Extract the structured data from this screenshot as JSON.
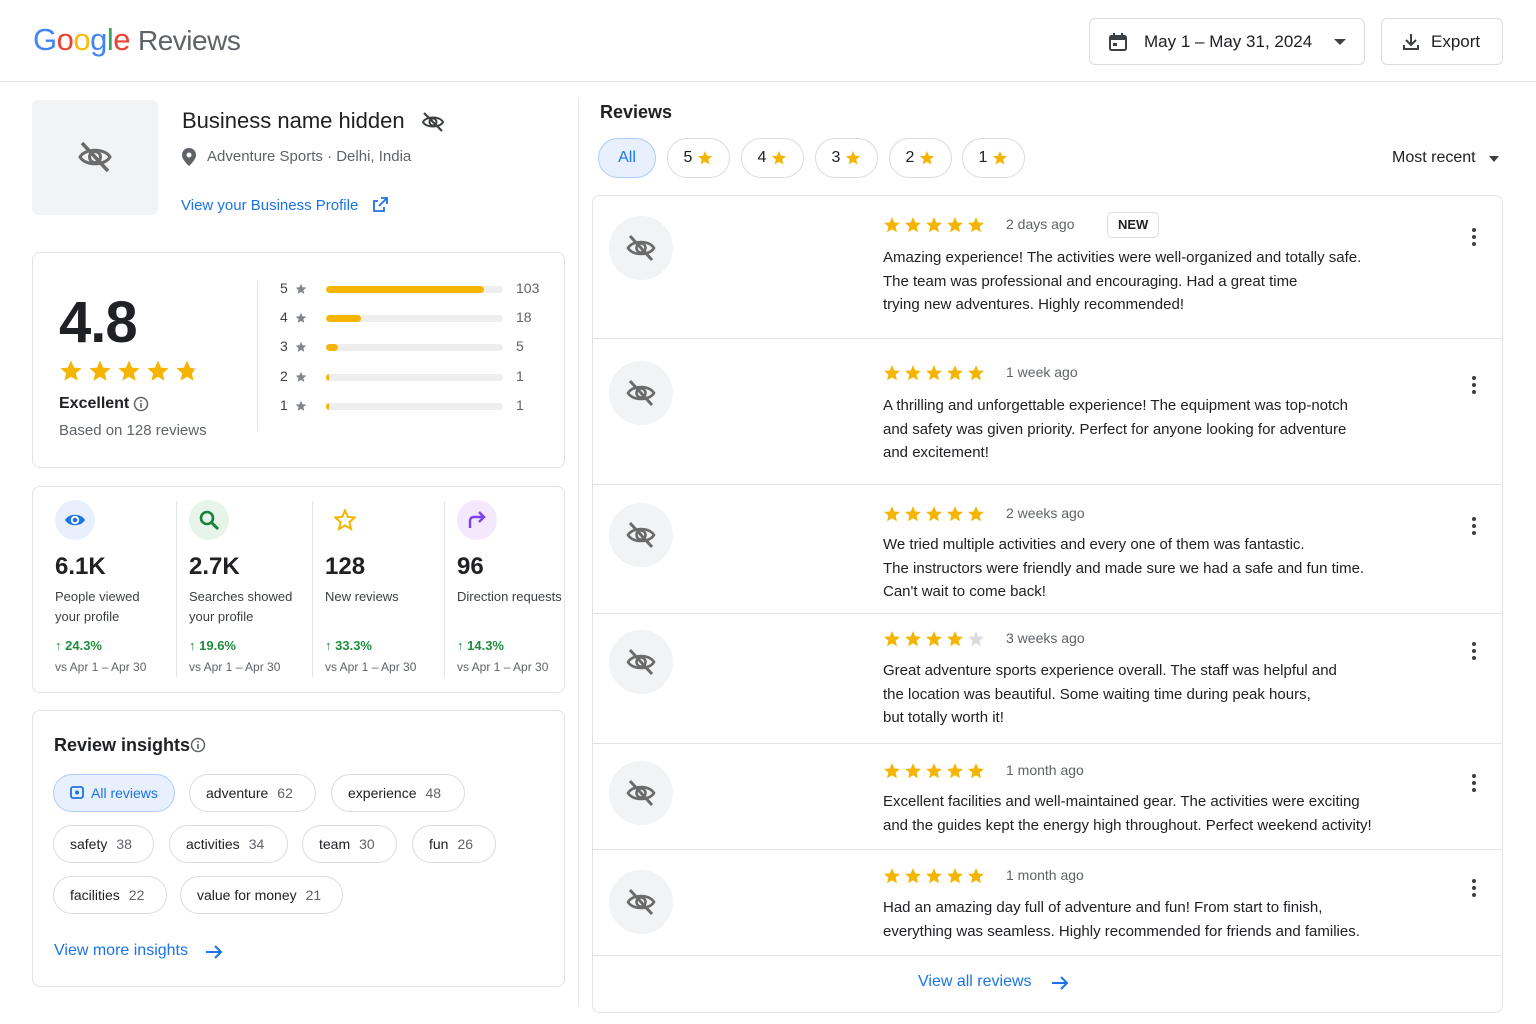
{
  "header": {
    "logo_google": "Google",
    "logo_product": "Reviews",
    "date_range": "May 1 – May 31, 2024",
    "export_label": "Export"
  },
  "business": {
    "name": "Business name hidden",
    "location": "Adventure Sports · Delhi, India",
    "profile_link": "View your Business Profile"
  },
  "rating": {
    "value": "4.8",
    "stars": 4.8,
    "label": "Excellent",
    "based_on": "Based on 128 reviews",
    "distribution": [
      {
        "star": "5",
        "count": "103",
        "fraction": 0.89
      },
      {
        "star": "4",
        "count": "18",
        "fraction": 0.2
      },
      {
        "star": "3",
        "count": "5",
        "fraction": 0.07
      },
      {
        "star": "2",
        "count": "1",
        "fraction": 0.015
      },
      {
        "star": "1",
        "count": "1",
        "fraction": 0.015
      }
    ]
  },
  "stats": [
    {
      "icon": "eye-icon",
      "value": "6.1K",
      "label": "People viewed your profile",
      "change": "24.3%",
      "compare": "vs Apr 1 – Apr 30",
      "color": "#1a73e8",
      "bg": "#e8f0fe"
    },
    {
      "icon": "search-icon",
      "value": "2.7K",
      "label": "Searches showed your profile",
      "change": "19.6%",
      "compare": "vs Apr 1 – Apr 30",
      "color": "#188038",
      "bg": "#e6f4ea"
    },
    {
      "icon": "star-outline-icon",
      "value": "128",
      "label": "New reviews",
      "change": "33.3%",
      "compare": "vs Apr 1 – Apr 30",
      "color": "#f4b400",
      "bg": "#ffffff"
    },
    {
      "icon": "direction-arrow-icon",
      "value": "96",
      "label": "Direction requests",
      "change": "14.3%",
      "compare": "vs Apr 1 – Apr 30",
      "color": "#7b3ff2",
      "bg": "#f3e8fd"
    }
  ],
  "insights": {
    "title": "Review insights",
    "chips": [
      {
        "label": "All reviews",
        "count": ""
      },
      {
        "label": "adventure",
        "count": "62"
      },
      {
        "label": "experience",
        "count": "48"
      },
      {
        "label": "safety",
        "count": "38"
      },
      {
        "label": "activities",
        "count": "34"
      },
      {
        "label": "team",
        "count": "30"
      },
      {
        "label": "fun",
        "count": "26"
      },
      {
        "label": "facilities",
        "count": "22"
      },
      {
        "label": "value for money",
        "count": "21"
      }
    ],
    "more_link": "View more insights"
  },
  "reviews_panel": {
    "title": "Reviews",
    "filters": [
      "All",
      "5",
      "4",
      "3",
      "2",
      "1"
    ],
    "sort": "Most recent",
    "view_all": "View all reviews",
    "reviews": [
      {
        "rating": 5,
        "time": "2 days ago",
        "badge": "NEW",
        "lines": [
          "Amazing experience! The activities were well-organized and totally safe.",
          "The team was professional and encouraging. Had a great time",
          "trying new adventures. Highly recommended!"
        ]
      },
      {
        "rating": 5,
        "time": "1 week ago",
        "badge": "",
        "lines": [
          "A thrilling and unforgettable experience! The equipment was top-notch",
          "and safety was given priority. Perfect for anyone looking for adventure",
          "and excitement!"
        ]
      },
      {
        "rating": 5,
        "time": "2 weeks ago",
        "badge": "",
        "lines": [
          "We tried multiple activities and every one of them was fantastic.",
          "The instructors were friendly and made sure we had a safe and fun time.",
          "Can't wait to come back!"
        ]
      },
      {
        "rating": 4,
        "time": "3 weeks ago",
        "badge": "",
        "lines": [
          "Great adventure sports experience overall. The staff was helpful and",
          "the location was beautiful. Some waiting time during peak hours,",
          "but totally worth it!"
        ]
      },
      {
        "rating": 5,
        "time": "1 month ago",
        "badge": "",
        "lines": [
          "Excellent facilities and well-maintained gear. The activities were exciting",
          "and the guides kept the energy high throughout. Perfect weekend activity!"
        ]
      },
      {
        "rating": 5,
        "time": "1 month ago",
        "badge": "",
        "lines": [
          "Had an amazing day full of adventure and fun! From start to finish,",
          "everything was seamless. Highly recommended for friends and families."
        ]
      }
    ]
  }
}
